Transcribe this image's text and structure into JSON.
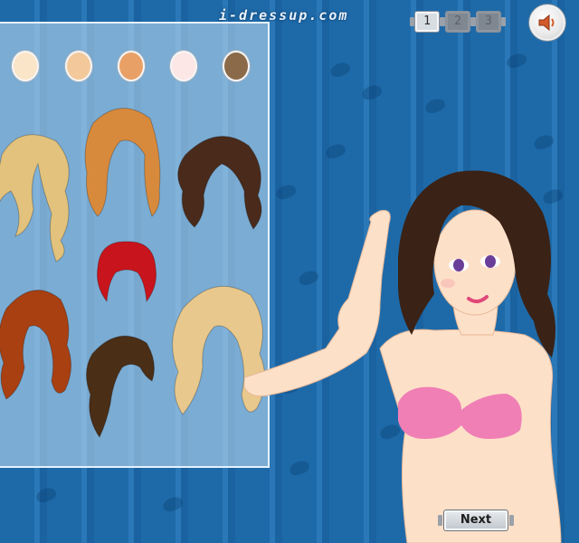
{
  "header": {
    "logo_text": "i-dressup.com",
    "page_tabs": [
      {
        "label": "1",
        "active": true
      },
      {
        "label": "2",
        "active": false
      },
      {
        "label": "3",
        "active": false
      }
    ],
    "sound_icon": "speaker-icon"
  },
  "palette": {
    "skin_tones": [
      "#fbe5c8",
      "#f3c99b",
      "#e9a066",
      "#fde6e6",
      "#8a6a48"
    ]
  },
  "hair_options": [
    {
      "name": "long-wavy-blonde",
      "color": "#e2c27c"
    },
    {
      "name": "long-straight-auburn",
      "color": "#d88a3c"
    },
    {
      "name": "wavy-dark-brown",
      "color": "#4a2a1a"
    },
    {
      "name": "updo-red",
      "color": "#c8141c"
    },
    {
      "name": "curly-copper",
      "color": "#a84012"
    },
    {
      "name": "wavy-brown",
      "color": "#4a2e16"
    },
    {
      "name": "long-curly-blonde",
      "color": "#e8c88c"
    }
  ],
  "model": {
    "hair_color": "#3a2216",
    "skin_color": "#fde0c8",
    "top_color": "#f07fb6"
  },
  "footer": {
    "next_label": "Next"
  },
  "theme": {
    "background": "#1f6cab",
    "panel_border": "#e6f1fb"
  }
}
